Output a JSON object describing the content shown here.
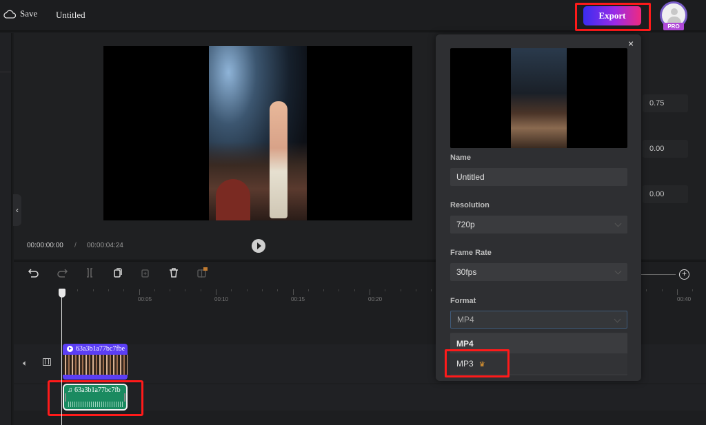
{
  "topbar": {
    "save_label": "Save",
    "project_title": "Untitled",
    "export_label": "Export",
    "pro_badge": "PRO",
    "icons": {
      "save": "cloud-icon",
      "avatar": "user-avatar-icon"
    }
  },
  "player": {
    "current_time": "00:00:00:00",
    "separator": "/",
    "total_time": "00:00:04:24",
    "collapse_icon": "‹"
  },
  "properties": {
    "values": [
      "0.75",
      "0.00",
      "0.00"
    ]
  },
  "toolbar": {
    "tools": [
      "undo",
      "redo",
      "split",
      "duplicate",
      "add",
      "delete",
      "replace-pro"
    ],
    "zoom_in": "+"
  },
  "timeline": {
    "ruler_labels": [
      "00:05",
      "00:10",
      "00:15",
      "00:20",
      "00:40"
    ],
    "video_clip_name": "63a3b1a77bc7fbe",
    "audio_clip_name": "63a3b1a77bc7fb"
  },
  "export_modal": {
    "close_icon": "×",
    "name_label": "Name",
    "name_value": "Untitled",
    "resolution_label": "Resolution",
    "resolution_value": "720p",
    "frame_rate_label": "Frame Rate",
    "frame_rate_value": "30fps",
    "format_label": "Format",
    "format_value": "MP4",
    "format_options": [
      {
        "label": "MP4",
        "premium": false,
        "selected": true
      },
      {
        "label": "MP3",
        "premium": true,
        "selected": false
      }
    ],
    "premium_icon": "crown-icon"
  },
  "colors": {
    "export_gradient_start": "#3a2df0",
    "export_gradient_end": "#ef2a7f",
    "highlight": "#ff1a1a",
    "video_clip": "#5b3ef5",
    "audio_clip": "#1a8a60",
    "crown": "#f0a030"
  }
}
